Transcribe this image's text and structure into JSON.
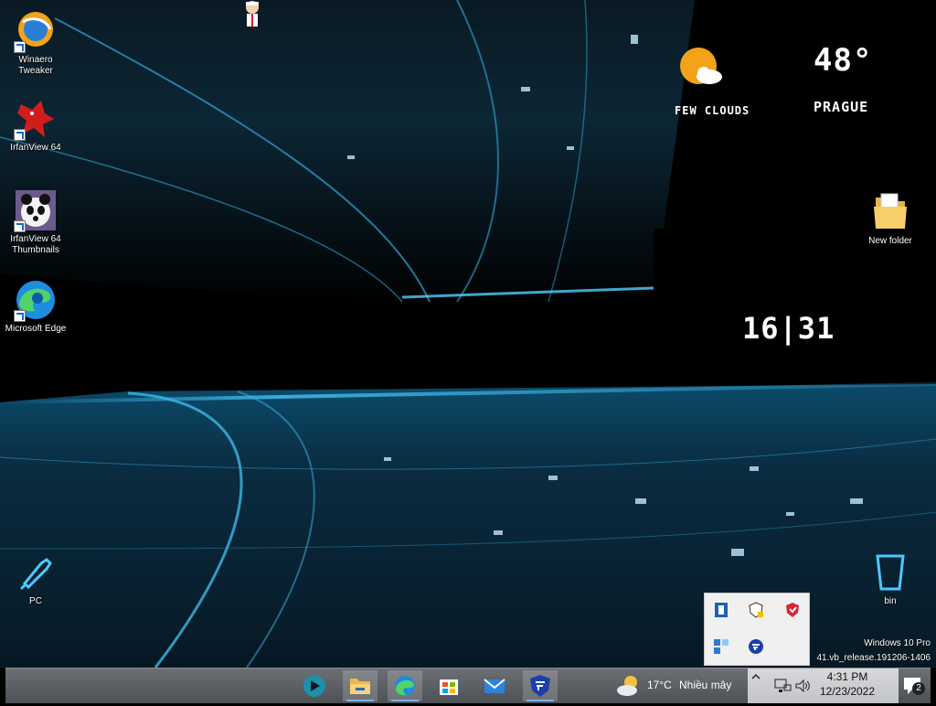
{
  "desktop": {
    "icons": [
      {
        "label": "Winaero\nTweaker",
        "line1": "Winaero",
        "line2": "Tweaker"
      },
      {
        "label": "IrfanView 64"
      },
      {
        "label": "IrfanView 64 Thumbnails",
        "line1": "IrfanView 64",
        "line2": "Thumbnails"
      },
      {
        "label": "Microsoft Edge"
      },
      {
        "label": "PC"
      },
      {
        "label": "New folder"
      },
      {
        "label": "bin"
      }
    ]
  },
  "weather_widget": {
    "condition": "FEW CLOUDS",
    "temperature": "48°",
    "city": "PRAGUE"
  },
  "clock_widget": {
    "time": "16|31"
  },
  "watermark": {
    "edition": "Windows 10 Pro",
    "build": "41.vb_release.191206-1406"
  },
  "taskbar": {
    "weather_temp": "17°C",
    "weather_desc": "Nhiều mây",
    "time": "4:31 PM",
    "date": "12/23/2022",
    "notification_count": "2"
  },
  "colors": {
    "taskbar": "#5b5e62",
    "accent": "#7ab6ff",
    "wallpaper_glow": "#3fb6e8"
  }
}
